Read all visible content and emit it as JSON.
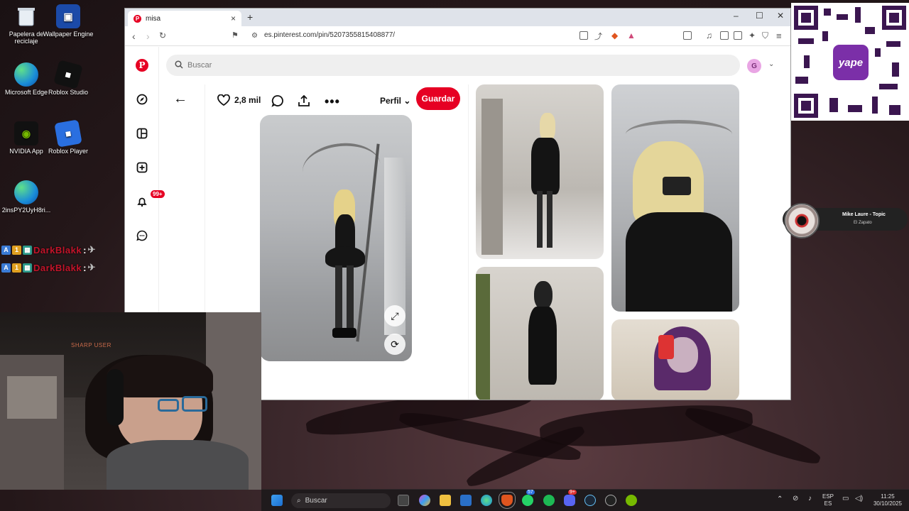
{
  "desktop": {
    "icons": [
      {
        "label": "Papelera de reciclaje",
        "icon": "recycle-bin-icon"
      },
      {
        "label": "Wallpaper Engine",
        "icon": "wallpaper-engine-icon"
      },
      {
        "label": "Microsoft Edge",
        "icon": "edge-icon"
      },
      {
        "label": "Roblox Studio",
        "icon": "roblox-studio-icon"
      },
      {
        "label": "NVIDIA App",
        "icon": "nvidia-icon"
      },
      {
        "label": "Roblox Player",
        "icon": "roblox-player-icon"
      },
      {
        "label": "2insPY2UyH8ri...",
        "icon": "edge-shortcut-icon"
      }
    ],
    "chat": [
      {
        "name": "DarkBlakk",
        "sep": ":"
      },
      {
        "name": "DarkBlakk",
        "sep": ":"
      }
    ]
  },
  "browser": {
    "tab_title": "misa",
    "new_tab": "+",
    "url": "es.pinterest.com/pin/5207355815408877/",
    "window_controls": [
      "–",
      "☐",
      "✕"
    ]
  },
  "pinterest": {
    "search_placeholder": "Buscar",
    "avatar_initial": "G",
    "notifications_badge": "99+",
    "likes": "2,8 mil",
    "profile_label": "Perfil",
    "save_label": "Guardar"
  },
  "overlays": {
    "qr_brand": "yape",
    "music_title": "Mike Laure - Topic",
    "music_subtitle": "El Zapato",
    "webcam_text": "SHARP USER"
  },
  "taskbar": {
    "search_label": "Buscar",
    "lang_top": "ESP",
    "lang_bottom": "ES",
    "time": "11:25",
    "date": "30/10/2025",
    "whatsapp_badge": "57",
    "discord_badge": "9+"
  },
  "colors": {
    "pinterest_red": "#e60023",
    "yape_purple": "#7b2fa8"
  }
}
